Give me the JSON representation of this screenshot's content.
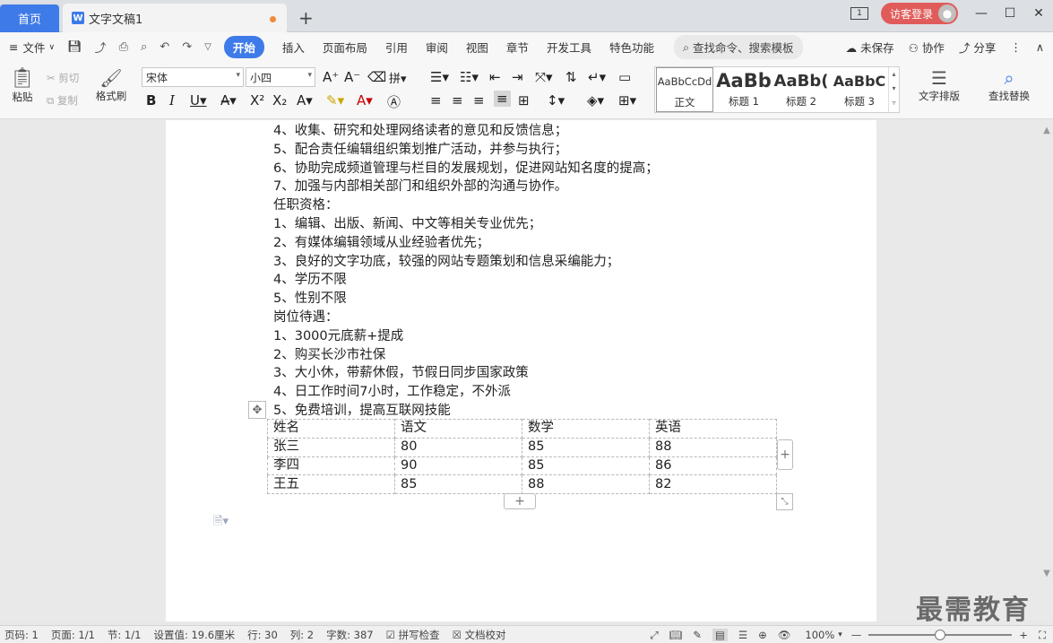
{
  "tabs": {
    "home": "首页",
    "doc_title": "文字文稿1",
    "new_tab": "+"
  },
  "window": {
    "box_label": "1",
    "visitor_login": "访客登录",
    "minimize": "—",
    "maximize": "☐",
    "close": "✕"
  },
  "menu": {
    "file": "文件",
    "items": [
      "开始",
      "插入",
      "页面布局",
      "引用",
      "审阅",
      "视图",
      "章节",
      "开发工具",
      "特色功能"
    ],
    "search_placeholder": "查找命令、搜索模板",
    "unsaved": "未保存",
    "collab": "协作",
    "share": "分享"
  },
  "ribbon": {
    "paste": "粘贴",
    "cut": "剪切",
    "copy": "复制",
    "format_painter": "格式刷",
    "font_name": "宋体",
    "font_size": "小四",
    "styles": [
      {
        "preview": "AaBbCcDd",
        "name": "正文"
      },
      {
        "preview": "AaBb",
        "name": "标题 1"
      },
      {
        "preview": "AaBb(",
        "name": "标题 2"
      },
      {
        "preview": "AaBbC",
        "name": "标题 3"
      }
    ],
    "text_layout": "文字排版",
    "find_replace": "查找替换"
  },
  "document": {
    "lines": [
      "4、收集、研究和处理网络读者的意见和反馈信息；",
      "5、配合责任编辑组织策划推广活动，并参与执行；",
      "6、协助完成频道管理与栏目的发展规划，促进网站知名度的提高；",
      "7、加强与内部相关部门和组织外部的沟通与协作。",
      "任职资格：",
      "1、编辑、出版、新闻、中文等相关专业优先；",
      "2、有媒体编辑领域从业经验者优先；",
      "3、良好的文字功底，较强的网站专题策划和信息采编能力；",
      "4、学历不限",
      "5、性别不限",
      "岗位待遇：",
      "1、3000元底薪+提成",
      "2、购买长沙市社保",
      "3、大小休，带薪休假，节假日同步国家政策",
      "4、日工作时间7小时，工作稳定，不外派",
      "5、免费培训，提高互联网技能"
    ],
    "table": {
      "header": [
        "姓名",
        "语文",
        "数学",
        "英语"
      ],
      "rows": [
        [
          "张三",
          "80",
          "85",
          "88"
        ],
        [
          "李四",
          "90",
          "85",
          "86"
        ],
        [
          "王五",
          "85",
          "88",
          "82"
        ]
      ]
    }
  },
  "status": {
    "page_num": "页码: 1",
    "pages": "页面: 1/1",
    "section": "节: 1/1",
    "setting": "设置值: 19.6厘米",
    "row": "行: 30",
    "col": "列: 2",
    "words": "字数: 387",
    "spell": "拼写检查",
    "proof": "文档校对",
    "zoom": "100%",
    "zoom_level": 0.5
  },
  "watermark": "最需教育",
  "colors": {
    "accent": "#3f7be8",
    "visitor": "#e05c5a",
    "unsaved_dot": "#f08a3a"
  }
}
